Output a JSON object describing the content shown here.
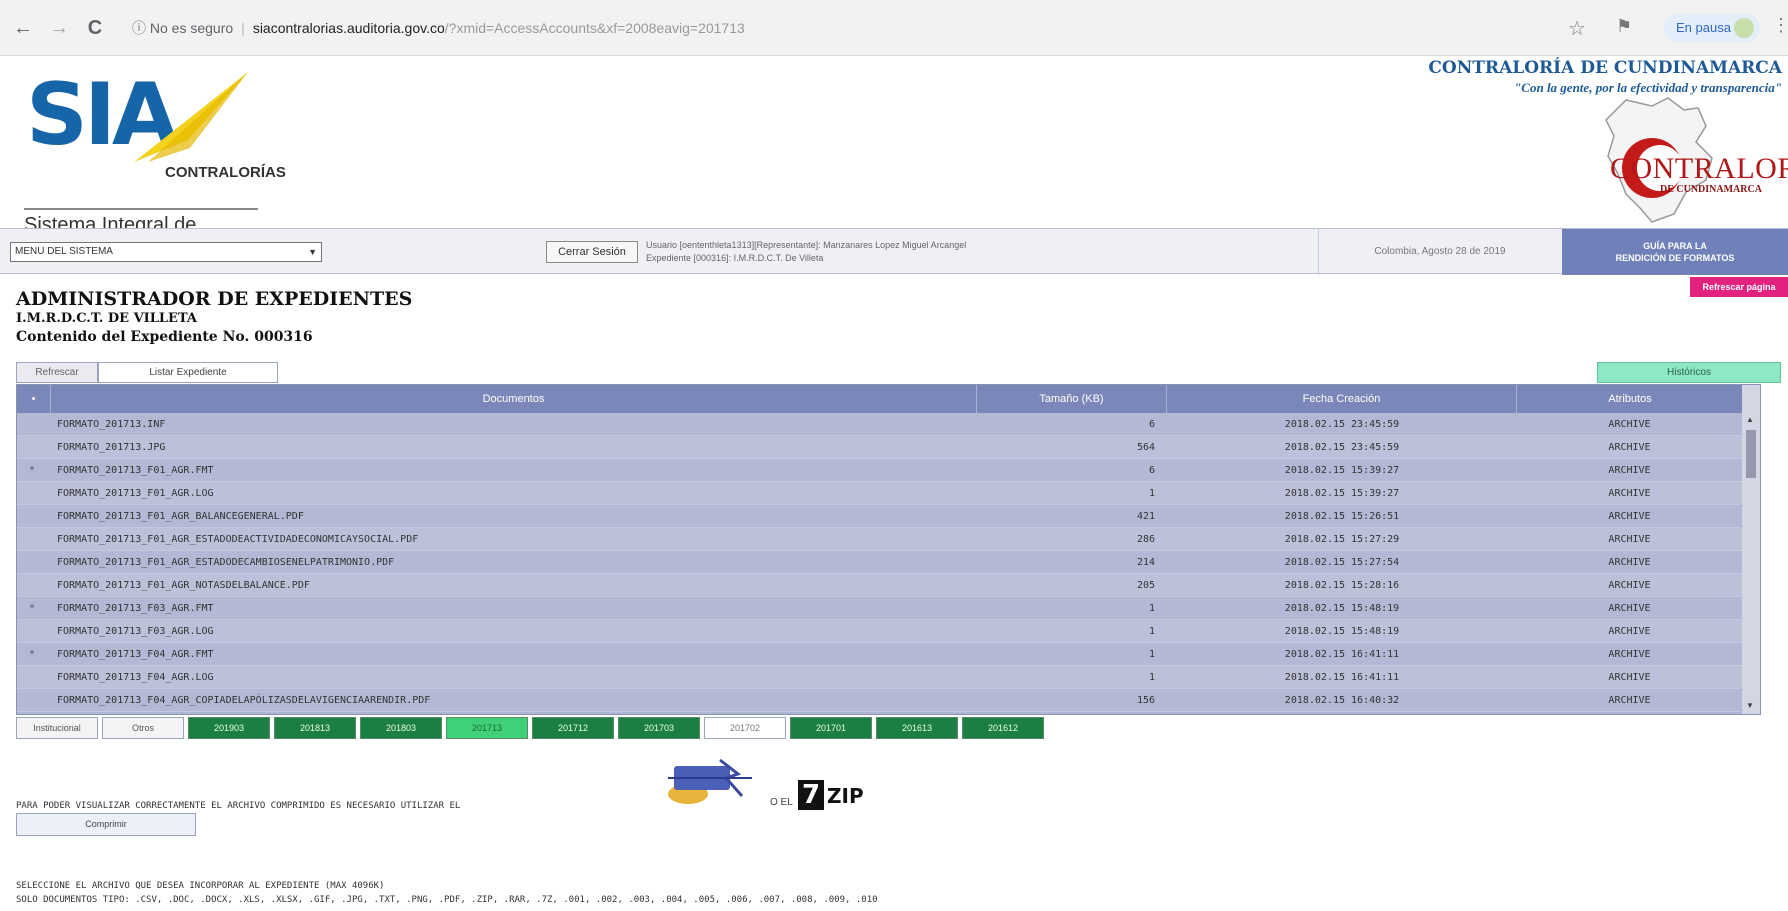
{
  "browser": {
    "back_icon": "←",
    "forward_icon": "→",
    "reload_icon": "C",
    "security_label": "No es seguro",
    "url_domain": "siacontralorias.auditoria.gov.co",
    "url_path": "/?xmid=AccessAccounts&xf=2008eavig=201713",
    "pause_label": "En pausa"
  },
  "header": {
    "logo_text": "SIA",
    "logo_tag": "CONTRALORÍAS",
    "logo_subtitle": "Sistema Integral de Auditoría",
    "entity_title": "CONTRALORÍA DE CUNDINAMARCA",
    "entity_motto": "\"Con la gente, por la efectividad y transparencia\"",
    "entity_logo_word": "CONTRALORIA",
    "entity_logo_sub": "DE CUNDINAMARCA"
  },
  "system_bar": {
    "menu_label": "MENU DEL SISTEMA",
    "logout_label": "Cerrar Sesión",
    "user_line": "Usuario [oententhleta1313][Representante]: Manzanares Lopez Miguel Arcangel",
    "expediente_line": "Expediente [000316]: I.M.R.D.C.T. De Villeta",
    "date": "Colombia, Agosto 28 de 2019",
    "guide_line1": "GUÍA PARA LA",
    "guide_line2": "RENDICIÓN DE FORMATOS"
  },
  "page": {
    "title": "ADMINISTRADOR DE EXPEDIENTES",
    "entity_name": "I.M.R.D.C.T. DE VILLETA",
    "contents_label": "Contenido del Expediente No. 000316",
    "refresh_page_label": "Refrescar página",
    "tab_refresh": "Refrescar",
    "tab_list": "Listar Expediente",
    "historicos_label": "Históricos"
  },
  "table": {
    "headers": {
      "select": "•",
      "documents": "Documentos",
      "size": "Tamaño (KB)",
      "date": "Fecha Creación",
      "attributes": "Atributos"
    },
    "rows": [
      {
        "mark": "",
        "name": "FORMATO_201713.INF",
        "size": "6",
        "date": "2018.02.15 23:45:59",
        "attr": "ARCHIVE"
      },
      {
        "mark": "",
        "name": "FORMATO_201713.JPG",
        "size": "564",
        "date": "2018.02.15 23:45:59",
        "attr": "ARCHIVE"
      },
      {
        "mark": "*",
        "name": "FORMATO_201713_F01_AGR.FMT",
        "size": "6",
        "date": "2018.02.15 15:39:27",
        "attr": "ARCHIVE"
      },
      {
        "mark": "",
        "name": "FORMATO_201713_F01_AGR.LOG",
        "size": "1",
        "date": "2018.02.15 15:39:27",
        "attr": "ARCHIVE"
      },
      {
        "mark": "",
        "name": "FORMATO_201713_F01_AGR_BALANCEGENERAL.PDF",
        "size": "421",
        "date": "2018.02.15 15:26:51",
        "attr": "ARCHIVE"
      },
      {
        "mark": "",
        "name": "FORMATO_201713_F01_AGR_ESTADODEACTIVIDADECONOMICAYSOCIAL.PDF",
        "size": "286",
        "date": "2018.02.15 15:27:29",
        "attr": "ARCHIVE"
      },
      {
        "mark": "",
        "name": "FORMATO_201713_F01_AGR_ESTADODECAMBIOSENELPATRIMONIO.PDF",
        "size": "214",
        "date": "2018.02.15 15:27:54",
        "attr": "ARCHIVE"
      },
      {
        "mark": "",
        "name": "FORMATO_201713_F01_AGR_NOTASDELBALANCE.PDF",
        "size": "205",
        "date": "2018.02.15 15:28:16",
        "attr": "ARCHIVE"
      },
      {
        "mark": "*",
        "name": "FORMATO_201713_F03_AGR.FMT",
        "size": "1",
        "date": "2018.02.15 15:48:19",
        "attr": "ARCHIVE"
      },
      {
        "mark": "",
        "name": "FORMATO_201713_F03_AGR.LOG",
        "size": "1",
        "date": "2018.02.15 15:48:19",
        "attr": "ARCHIVE"
      },
      {
        "mark": "*",
        "name": "FORMATO_201713_F04_AGR.FMT",
        "size": "1",
        "date": "2018.02.15 16:41:11",
        "attr": "ARCHIVE"
      },
      {
        "mark": "",
        "name": "FORMATO_201713_F04_AGR.LOG",
        "size": "1",
        "date": "2018.02.15 16:41:11",
        "attr": "ARCHIVE"
      },
      {
        "mark": "",
        "name": "FORMATO_201713_F04_AGR_COPIADELAPÓLIZASDELAVIGENCIAARENDIR.PDF",
        "size": "156",
        "date": "2018.02.15 16:40:32",
        "attr": "ARCHIVE"
      }
    ]
  },
  "period_tabs": [
    {
      "label": "Institucional",
      "style": "gray"
    },
    {
      "label": "Otros",
      "style": "gray"
    },
    {
      "label": "201903",
      "style": "green"
    },
    {
      "label": "201813",
      "style": "green"
    },
    {
      "label": "201803",
      "style": "green"
    },
    {
      "label": "201713",
      "style": "active"
    },
    {
      "label": "201712",
      "style": "green"
    },
    {
      "label": "201703",
      "style": "green"
    },
    {
      "label": "201702",
      "style": "white"
    },
    {
      "label": "201701",
      "style": "green"
    },
    {
      "label": "201613",
      "style": "green"
    },
    {
      "label": "201612",
      "style": "green"
    }
  ],
  "bottom": {
    "compress_notice": "PARA PODER VISUALIZAR CORRECTAMENTE EL ARCHIVO COMPRIMIDO ES NECESARIO UTILIZAR EL",
    "o_el": "O EL",
    "zip_seven": "7",
    "zip_word": "ZIP",
    "compress_button": "Comprimir",
    "select_file": "SELECCIONE EL ARCHIVO QUE DESEA INCORPORAR AL EXPEDIENTE (MAX 4096K)",
    "doc_types": "SOLO DOCUMENTOS TIPO: .CSV, .DOC, .DOCX, .XLS, .XLSX, .GIF, .JPG, .TXT, .PNG, .PDF, .ZIP, .RAR, .7Z, .001, .002, .003, .004, .005, .006, .007, .008, .009, .010"
  },
  "icons": {
    "info": "info-icon",
    "star": "star-icon",
    "flag": "flag-icon",
    "menu": "kebab-icon",
    "winrar": "winrar-logo"
  },
  "colors": {
    "header_blue": "#7c87b9",
    "row_blue": "#b3b9d4",
    "tab_green": "#1b7f43",
    "tab_active": "#40d07a",
    "historicos": "#8ee8c6",
    "refresh_page": "#e3217e",
    "guide": "#6f81b8"
  }
}
